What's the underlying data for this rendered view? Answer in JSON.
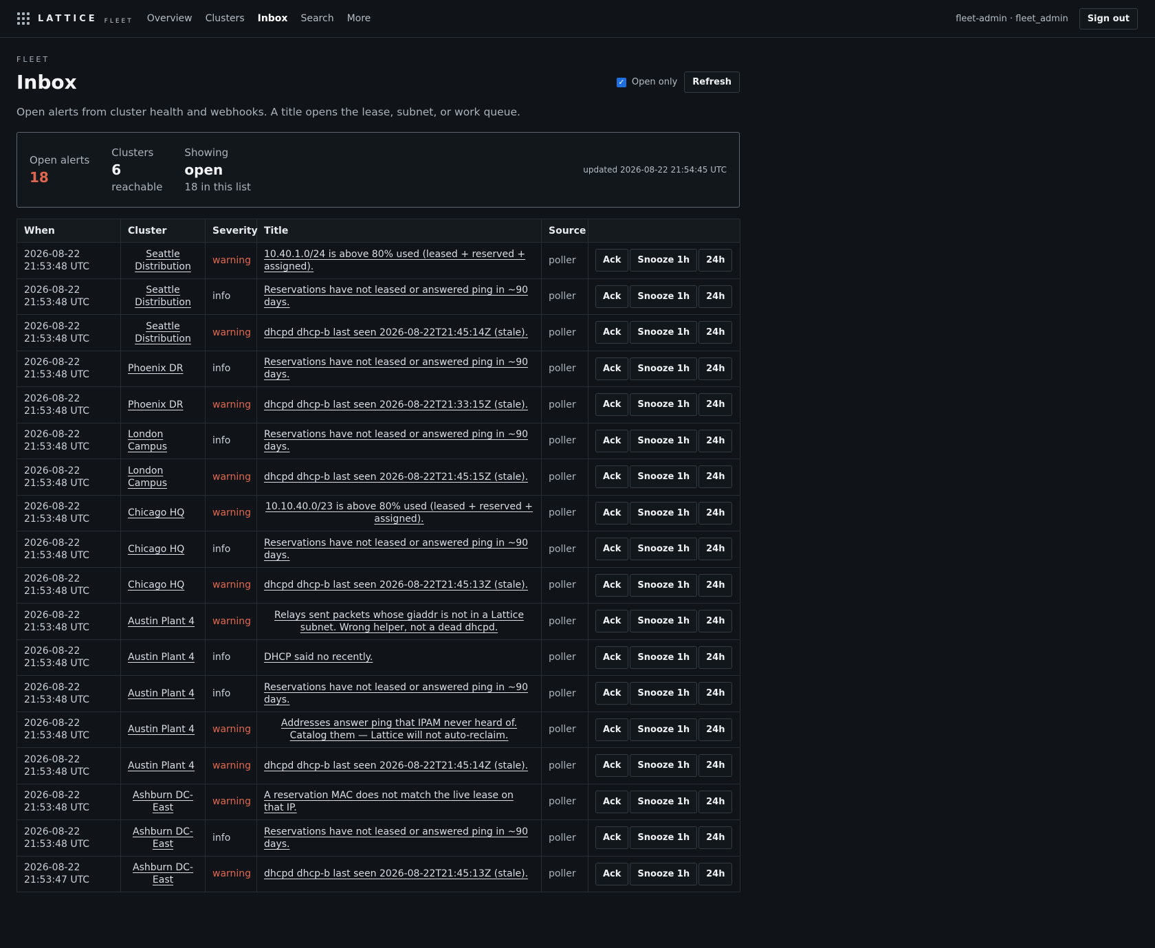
{
  "brand": {
    "name": "LATTICE",
    "sub": "FLEET"
  },
  "nav": [
    {
      "label": "Overview",
      "active": false
    },
    {
      "label": "Clusters",
      "active": false
    },
    {
      "label": "Inbox",
      "active": true
    },
    {
      "label": "Search",
      "active": false
    },
    {
      "label": "More",
      "active": false
    }
  ],
  "user": {
    "label": "fleet-admin · fleet_admin",
    "signout": "Sign out"
  },
  "page": {
    "eyebrow": "FLEET",
    "title": "Inbox",
    "open_only_label": "Open only",
    "open_only_checked": true,
    "refresh_label": "Refresh",
    "description": "Open alerts from cluster health and webhooks. A title opens the lease, subnet, or work queue."
  },
  "summary": {
    "open_alerts_label": "Open alerts",
    "open_alerts_value": "18",
    "clusters_label": "Clusters",
    "clusters_value": "6",
    "clusters_sub": "reachable",
    "showing_label": "Showing",
    "showing_value": "open",
    "showing_sub": "18 in this list",
    "updated": "updated 2026-08-22 21:54:45 UTC"
  },
  "colors": {
    "warning": "#e0674f",
    "accent": "#1f6fe0",
    "background": "#101418"
  },
  "table": {
    "headers": [
      "When",
      "Cluster",
      "Severity",
      "Title",
      "Source",
      ""
    ],
    "action_labels": {
      "ack": "Ack",
      "snooze": "Snooze 1h",
      "day": "24h"
    },
    "rows": [
      {
        "date": "2026-08-22",
        "time": "21:53:48 UTC",
        "cluster": "Seattle Distribution",
        "severity": "warning",
        "title": "10.40.1.0/24 is above 80% used (leased + reserved + assigned).",
        "source": "poller"
      },
      {
        "date": "2026-08-22",
        "time": "21:53:48 UTC",
        "cluster": "Seattle Distribution",
        "severity": "info",
        "title": "Reservations have not leased or answered ping in ~90 days.",
        "source": "poller"
      },
      {
        "date": "2026-08-22",
        "time": "21:53:48 UTC",
        "cluster": "Seattle Distribution",
        "severity": "warning",
        "title": "dhcpd dhcp-b last seen 2026-08-22T21:45:14Z (stale).",
        "source": "poller"
      },
      {
        "date": "2026-08-22",
        "time": "21:53:48 UTC",
        "cluster": "Phoenix DR",
        "severity": "info",
        "title": "Reservations have not leased or answered ping in ~90 days.",
        "source": "poller"
      },
      {
        "date": "2026-08-22",
        "time": "21:53:48 UTC",
        "cluster": "Phoenix DR",
        "severity": "warning",
        "title": "dhcpd dhcp-b last seen 2026-08-22T21:33:15Z (stale).",
        "source": "poller"
      },
      {
        "date": "2026-08-22",
        "time": "21:53:48 UTC",
        "cluster": "London Campus",
        "severity": "info",
        "title": "Reservations have not leased or answered ping in ~90 days.",
        "source": "poller"
      },
      {
        "date": "2026-08-22",
        "time": "21:53:48 UTC",
        "cluster": "London Campus",
        "severity": "warning",
        "title": "dhcpd dhcp-b last seen 2026-08-22T21:45:15Z (stale).",
        "source": "poller"
      },
      {
        "date": "2026-08-22",
        "time": "21:53:48 UTC",
        "cluster": "Chicago HQ",
        "severity": "warning",
        "title": "10.10.40.0/23 is above 80% used (leased + reserved + assigned).",
        "source": "poller"
      },
      {
        "date": "2026-08-22",
        "time": "21:53:48 UTC",
        "cluster": "Chicago HQ",
        "severity": "info",
        "title": "Reservations have not leased or answered ping in ~90 days.",
        "source": "poller"
      },
      {
        "date": "2026-08-22",
        "time": "21:53:48 UTC",
        "cluster": "Chicago HQ",
        "severity": "warning",
        "title": "dhcpd dhcp-b last seen 2026-08-22T21:45:13Z (stale).",
        "source": "poller"
      },
      {
        "date": "2026-08-22",
        "time": "21:53:48 UTC",
        "cluster": "Austin Plant 4",
        "severity": "warning",
        "title": "Relays sent packets whose giaddr is not in a Lattice subnet. Wrong helper, not a dead dhcpd.",
        "source": "poller"
      },
      {
        "date": "2026-08-22",
        "time": "21:53:48 UTC",
        "cluster": "Austin Plant 4",
        "severity": "info",
        "title": "DHCP said no recently.",
        "source": "poller"
      },
      {
        "date": "2026-08-22",
        "time": "21:53:48 UTC",
        "cluster": "Austin Plant 4",
        "severity": "info",
        "title": "Reservations have not leased or answered ping in ~90 days.",
        "source": "poller"
      },
      {
        "date": "2026-08-22",
        "time": "21:53:48 UTC",
        "cluster": "Austin Plant 4",
        "severity": "warning",
        "title": "Addresses answer ping that IPAM never heard of. Catalog them — Lattice will not auto-reclaim.",
        "source": "poller"
      },
      {
        "date": "2026-08-22",
        "time": "21:53:48 UTC",
        "cluster": "Austin Plant 4",
        "severity": "warning",
        "title": "dhcpd dhcp-b last seen 2026-08-22T21:45:14Z (stale).",
        "source": "poller"
      },
      {
        "date": "2026-08-22",
        "time": "21:53:48 UTC",
        "cluster": "Ashburn DC-East",
        "severity": "warning",
        "title": "A reservation MAC does not match the live lease on that IP.",
        "source": "poller"
      },
      {
        "date": "2026-08-22",
        "time": "21:53:48 UTC",
        "cluster": "Ashburn DC-East",
        "severity": "info",
        "title": "Reservations have not leased or answered ping in ~90 days.",
        "source": "poller"
      },
      {
        "date": "2026-08-22",
        "time": "21:53:47 UTC",
        "cluster": "Ashburn DC-East",
        "severity": "warning",
        "title": "dhcpd dhcp-b last seen 2026-08-22T21:45:13Z (stale).",
        "source": "poller"
      }
    ]
  }
}
